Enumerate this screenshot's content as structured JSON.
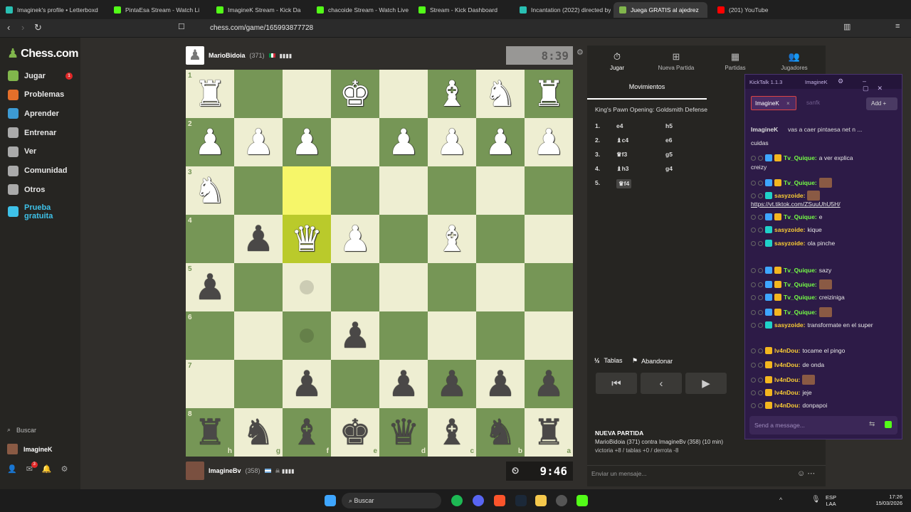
{
  "browser": {
    "tabs": [
      {
        "title": "Imaginek's profile • Letterboxd",
        "color": "#29c0b3"
      },
      {
        "title": "PintaEsa Stream - Watch Li",
        "color": "#53fc18"
      },
      {
        "title": "ImagineK Stream - Kick Da",
        "color": "#53fc18"
      },
      {
        "title": "chacoide Stream - Watch Live",
        "color": "#53fc18"
      },
      {
        "title": "Stream - Kick Dashboard",
        "color": "#53fc18"
      },
      {
        "title": "Incantation (2022) directed by",
        "color": "#29c0b3"
      },
      {
        "title": "Juega GRATIS al ajedrez",
        "color": "#81b64c"
      },
      {
        "title": "(201) YouTube",
        "color": "#ff0000"
      }
    ],
    "url": "chess.com/game/165993877728"
  },
  "sidebar": {
    "logo": "Chess.com",
    "items": [
      {
        "label": "Jugar",
        "icon": "play-icon",
        "color": "#81b64c",
        "badge": "1"
      },
      {
        "label": "Problemas",
        "icon": "puzzle-icon",
        "color": "#e46f2a"
      },
      {
        "label": "Aprender",
        "icon": "learn-icon",
        "color": "#3d9bd4"
      },
      {
        "label": "Entrenar",
        "icon": "train-icon",
        "color": "#aaaaaa"
      },
      {
        "label": "Ver",
        "icon": "watch-icon",
        "color": "#aaaaaa"
      },
      {
        "label": "Comunidad",
        "icon": "community-icon",
        "color": "#aaaaaa"
      },
      {
        "label": "Otros",
        "icon": "more-icon",
        "color": "#aaaaaa"
      },
      {
        "label": "Prueba gratuita",
        "icon": "diamond-icon",
        "color": "#3ec1e8"
      }
    ],
    "search": "Buscar",
    "user": "ImagineK",
    "notif_badge": "3"
  },
  "top_player": {
    "name": "MarioBidoia",
    "rating": "(371)",
    "clock": "8:39"
  },
  "bottom_player": {
    "name": "ImagineBv",
    "rating": "(358)",
    "clock": "9:46"
  },
  "board": {
    "ranks": [
      "1",
      "2",
      "3",
      "4",
      "5",
      "6",
      "7",
      "8"
    ],
    "files": [
      "h",
      "g",
      "f",
      "e",
      "d",
      "c",
      "b",
      "a"
    ],
    "rows": [
      [
        "wR",
        "",
        "",
        "wK",
        "",
        "wB",
        "wN",
        "wR"
      ],
      [
        "wP",
        "wP",
        "wP",
        "",
        "wP",
        "wP",
        "wP",
        "wP"
      ],
      [
        "wN",
        "",
        "",
        "",
        "",
        "",
        "",
        ""
      ],
      [
        "",
        "bP",
        "wQ",
        "wP",
        "",
        "wB",
        "",
        ""
      ],
      [
        "bP",
        "",
        "",
        "",
        "",
        "",
        "",
        ""
      ],
      [
        "",
        "",
        "",
        "bP",
        "",
        "",
        "",
        ""
      ],
      [
        "",
        "",
        "bP",
        "",
        "bP",
        "bP",
        "bP",
        "bP"
      ],
      [
        "bR",
        "bN",
        "bB",
        "bK",
        "bQ",
        "bB",
        "bN",
        "bR"
      ]
    ],
    "highlights": [
      "2-2",
      "3-2"
    ],
    "dots": [
      "4-2",
      "5-2"
    ]
  },
  "panel": {
    "tabs": [
      {
        "label": "Jugar",
        "icon": "clock-icon"
      },
      {
        "label": "Nueva Partida",
        "icon": "plus-icon"
      },
      {
        "label": "Partidas",
        "icon": "grid-icon"
      },
      {
        "label": "Jugadores",
        "icon": "players-icon"
      }
    ],
    "moves_tab": "Movimientos",
    "opening": "King's Pawn Opening: Goldsmith Defense",
    "moves": [
      {
        "n": "1.",
        "w": "e4",
        "b": "h5"
      },
      {
        "n": "2.",
        "w": "♝c4",
        "b": "e6"
      },
      {
        "n": "3.",
        "w": "♛f3",
        "b": "g5"
      },
      {
        "n": "4.",
        "w": "♝h3",
        "b": "g4"
      },
      {
        "n": "5.",
        "w": "♛f4",
        "b": ""
      }
    ],
    "draw": "Tablas",
    "draw_prefix": "½",
    "resign": "Abandonar",
    "new_game_title": "NUEVA PARTIDA",
    "new_game_line": "MarioBidoia (371) contra ImagineBv (358) (10 min)",
    "new_game_stats": "victoria +8 / tablas +0 / derrota -8",
    "chat_placeholder": "Enviar un mensaje..."
  },
  "kicktalk": {
    "title": "KickTalk 1.1.3",
    "title_tab": "ImagineK",
    "tabs": [
      "ImagineK",
      "sanfk"
    ],
    "add": "Add",
    "pinned": "ImagineK",
    "pinned_msg": "vas a caer pintaesa net n ...",
    "messages": [
      {
        "user": "",
        "text": "cuidas",
        "color": "#ffffff"
      },
      {
        "user": "Tv_Quique:",
        "text": "a ver explica",
        "color": "#75fd46"
      },
      {
        "user": "",
        "text": "creizy",
        "color": "#ffffff"
      },
      {
        "user": "Tv_Quique:",
        "text": "",
        "color": "#75fd46"
      },
      {
        "user": "sasyzoide:",
        "text": "",
        "color": "#fbcd34"
      },
      {
        "user": "",
        "text": "https://vt.tiktok.com/ZSuuUhU5H/",
        "color": "#ffffff"
      },
      {
        "user": "Tv_Quique:",
        "text": "e",
        "color": "#75fd46"
      },
      {
        "user": "sasyzoide:",
        "text": "kique",
        "color": "#fbcd34"
      },
      {
        "user": "sasyzoide:",
        "text": "ola pinche",
        "color": "#fbcd34"
      },
      {
        "user": "Tv_Quique:",
        "text": "sazy",
        "color": "#75fd46"
      },
      {
        "user": "Tv_Quique:",
        "text": "",
        "color": "#75fd46"
      },
      {
        "user": "Tv_Quique:",
        "text": "creiziniga",
        "color": "#75fd46"
      },
      {
        "user": "Tv_Quique:",
        "text": "",
        "color": "#75fd46"
      },
      {
        "user": "sasyzoide:",
        "text": "transformate en el super",
        "color": "#fbcd34"
      },
      {
        "user": "lv4nDou:",
        "text": "tocame el pingo",
        "color": "#fbcd34"
      },
      {
        "user": "lv4nDou:",
        "text": "de onda",
        "color": "#fbcd34"
      },
      {
        "user": "lv4nDou:",
        "text": "",
        "color": "#fbcd34"
      },
      {
        "user": "lv4nDou:",
        "text": "jeje",
        "color": "#fbcd34"
      },
      {
        "user": "lv4nDou:",
        "text": "donpapoi",
        "color": "#fbcd34"
      }
    ],
    "send_placeholder": "Send a message..."
  },
  "taskbar": {
    "search": "Buscar",
    "lang": "ESP",
    "lang2": "LAA",
    "time": "17:26",
    "date": "15/03/2026"
  }
}
